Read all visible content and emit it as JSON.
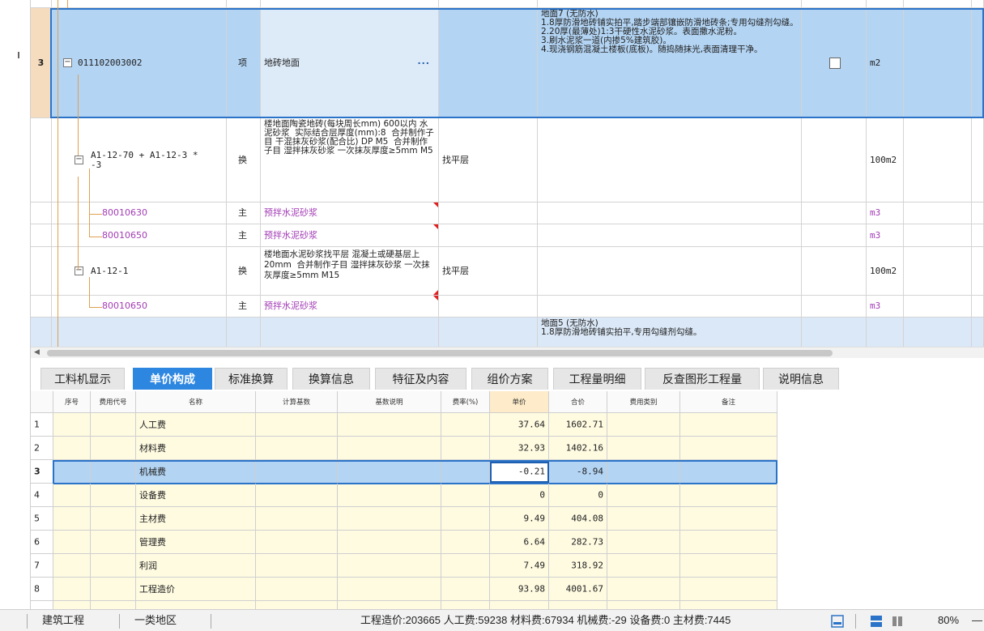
{
  "upper": {
    "top_partial": "",
    "row3": {
      "num": "3",
      "code": "011102003002",
      "unit_type": "项",
      "name": "地砖地面",
      "ellipsis": "···",
      "desc": "地面7 (无防水)\n1.8厚防滑地砖铺实拍平,踏步端部镶嵌防滑地砖条;专用勾缝剂勾缝。\n2.20厚(最薄处)1:3干硬性水泥砂浆。表面撒水泥粉。\n3.刷水泥浆一道(内掺5%建筑胶)。\n4.现浇钢筋混凝土楼板(底板)。随捣随抹光,表面清理干净。",
      "unit": "m2"
    },
    "sub1": {
      "code": "A1-12-70 + A1-12-3 *\n-3",
      "type": "换",
      "name": "楼地面陶瓷地砖(每块周长mm) 600以内 水泥砂浆  实际结合层厚度(mm):8  合并制作子目 干混抹灰砂浆(配合比) DP M5  合并制作子目 湿拌抹灰砂浆 一次抹灰厚度≥5mm M5",
      "spec": "找平层",
      "unit": "100m2"
    },
    "mat1": {
      "code": "80010630",
      "type": "主",
      "name": "预拌水泥砂浆",
      "unit": "m3"
    },
    "mat2": {
      "code": "80010650",
      "type": "主",
      "name": "预拌水泥砂浆",
      "unit": "m3"
    },
    "sub2": {
      "code": "A1-12-1",
      "type": "换",
      "name": "楼地面水泥砂浆找平层 混凝土或硬基层上 20mm  合并制作子目 湿拌抹灰砂浆 一次抹灰厚度≥5mm M15",
      "spec": "找平层",
      "unit": "100m2"
    },
    "mat3": {
      "code": "80010650",
      "type": "主",
      "name": "预拌水泥砂浆",
      "unit": "m3"
    },
    "next": {
      "desc": "地面5 (无防水)\n1.8厚防滑地砖铺实拍平,专用勾缝剂勾缝。"
    }
  },
  "tabs": [
    "工料机显示",
    "单价构成",
    "标准换算",
    "换算信息",
    "特征及内容",
    "组价方案",
    "工程量明细",
    "反查图形工程量",
    "说明信息"
  ],
  "active_tab": "单价构成",
  "lower": {
    "headers": [
      "序号",
      "费用代号",
      "名称",
      "计算基数",
      "基数说明",
      "费率(%)",
      "单价",
      "合价",
      "费用类别",
      "备注"
    ],
    "rows": [
      {
        "n": "1",
        "name": "人工费",
        "price": "37.64",
        "total": "1602.71"
      },
      {
        "n": "2",
        "name": "材料费",
        "price": "32.93",
        "total": "1402.16"
      },
      {
        "n": "3",
        "name": "机械费",
        "price": "-0.21",
        "total": "-8.94"
      },
      {
        "n": "4",
        "name": "设备费",
        "price": "0",
        "total": "0"
      },
      {
        "n": "5",
        "name": "主材费",
        "price": "9.49",
        "total": "404.08"
      },
      {
        "n": "6",
        "name": "管理费",
        "price": "6.64",
        "total": "282.73"
      },
      {
        "n": "7",
        "name": "利润",
        "price": "7.49",
        "total": "318.92"
      },
      {
        "n": "8",
        "name": "工程造价",
        "price": "93.98",
        "total": "4001.67"
      }
    ]
  },
  "status": {
    "project": "建筑工程",
    "region": "一类地区",
    "summary": "工程造价:203665  人工费:59238  材料费:67934  机械费:-29  设备费:0  主材费:7445",
    "zoom": "80%",
    "minus": "—"
  }
}
